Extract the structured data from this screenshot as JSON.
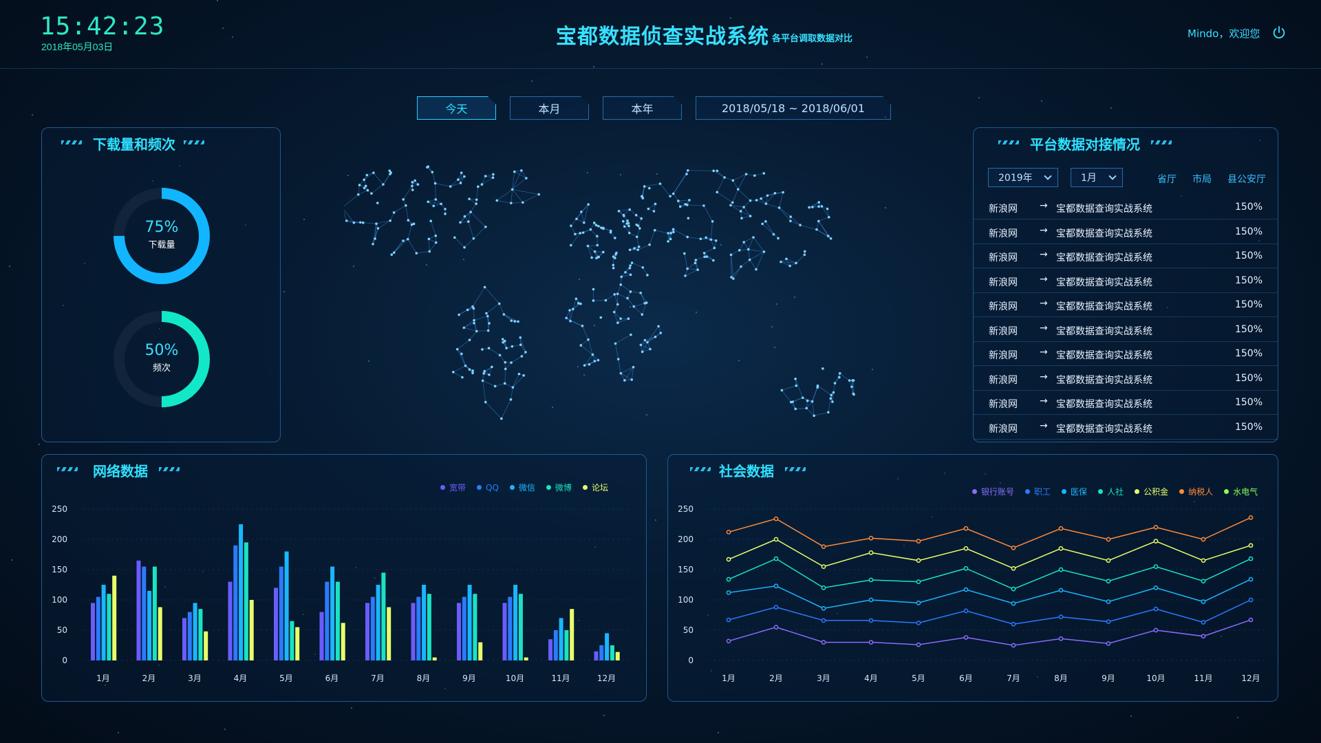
{
  "header": {
    "clock": "15:42:23",
    "date": "2018年05月03日",
    "title": "宝都数据侦查实战系统",
    "subtitle": "各平台调取数据对比",
    "welcome": "Mindo，欢迎您",
    "power_icon": "power-icon"
  },
  "tabs": {
    "today": "今天",
    "month": "本月",
    "year": "本年",
    "date_range": "2018/05/18  ~  2018/06/01"
  },
  "download_panel": {
    "title": "下载量和频次",
    "rings": [
      {
        "value": "75%",
        "label": "下载量",
        "fraction": 0.75,
        "color": "#12b5ff"
      },
      {
        "value": "50%",
        "label": "频次",
        "fraction": 0.5,
        "color": "#12e8c8"
      }
    ]
  },
  "platform_panel": {
    "title": "平台数据对接情况",
    "year_select": "2019年",
    "month_select": "1月",
    "filters": [
      "省厅",
      "市局",
      "县公安厅"
    ],
    "rows": [
      {
        "src": "新浪网",
        "dst": "宝都数据查询实战系统",
        "pct": "150%"
      },
      {
        "src": "新浪网",
        "dst": "宝都数据查询实战系统",
        "pct": "150%"
      },
      {
        "src": "新浪网",
        "dst": "宝都数据查询实战系统",
        "pct": "150%"
      },
      {
        "src": "新浪网",
        "dst": "宝都数据查询实战系统",
        "pct": "150%"
      },
      {
        "src": "新浪网",
        "dst": "宝都数据查询实战系统",
        "pct": "150%"
      },
      {
        "src": "新浪网",
        "dst": "宝都数据查询实战系统",
        "pct": "150%"
      },
      {
        "src": "新浪网",
        "dst": "宝都数据查询实战系统",
        "pct": "150%"
      },
      {
        "src": "新浪网",
        "dst": "宝都数据查询实战系统",
        "pct": "150%"
      },
      {
        "src": "新浪网",
        "dst": "宝都数据查询实战系统",
        "pct": "150%"
      },
      {
        "src": "新浪网",
        "dst": "宝都数据查询实战系统",
        "pct": "150%"
      }
    ]
  },
  "network_panel": {
    "title": "网络数据"
  },
  "social_panel": {
    "title": "社会数据"
  },
  "chart_data": [
    {
      "type": "bar",
      "categories": [
        "1月",
        "2月",
        "3月",
        "4月",
        "5月",
        "6月",
        "7月",
        "8月",
        "9月",
        "10月",
        "11月",
        "12月"
      ],
      "ylim": [
        0,
        250
      ],
      "yticks": [
        0,
        50,
        100,
        150,
        200,
        250
      ],
      "grid": true,
      "legend": "top-right",
      "series": [
        {
          "name": "宽带",
          "color": "#6a5cff",
          "values": [
            95,
            165,
            70,
            130,
            120,
            80,
            95,
            95,
            95,
            95,
            35,
            15
          ]
        },
        {
          "name": "QQ",
          "color": "#2b7bff",
          "values": [
            105,
            155,
            80,
            190,
            155,
            130,
            105,
            105,
            105,
            105,
            50,
            25
          ]
        },
        {
          "name": "微信",
          "color": "#1ab6ff",
          "values": [
            125,
            115,
            95,
            225,
            180,
            155,
            125,
            125,
            125,
            125,
            70,
            45
          ]
        },
        {
          "name": "微博",
          "color": "#19e3c3",
          "values": [
            110,
            155,
            85,
            195,
            65,
            130,
            145,
            110,
            110,
            110,
            50,
            25
          ]
        },
        {
          "name": "论坛",
          "color": "#e9ff6a",
          "values": [
            140,
            88,
            48,
            100,
            55,
            62,
            88,
            5,
            30,
            5,
            85,
            14
          ]
        }
      ]
    },
    {
      "type": "line",
      "categories": [
        "1月",
        "2月",
        "3月",
        "4月",
        "5月",
        "6月",
        "7月",
        "8月",
        "9月",
        "10月",
        "11月",
        "12月"
      ],
      "ylim": [
        0,
        250
      ],
      "yticks": [
        0,
        50,
        100,
        150,
        200,
        250
      ],
      "grid": true,
      "legend": "top-right",
      "series": [
        {
          "name": "银行账号",
          "color": "#8a6cff",
          "values": [
            32,
            55,
            30,
            30,
            26,
            38,
            25,
            36,
            28,
            50,
            40,
            67
          ]
        },
        {
          "name": "职工",
          "color": "#2b7bff",
          "values": [
            67,
            88,
            66,
            66,
            62,
            82,
            60,
            72,
            64,
            85,
            63,
            100
          ]
        },
        {
          "name": "医保",
          "color": "#1ab6ff",
          "values": [
            112,
            123,
            86,
            100,
            95,
            117,
            94,
            116,
            97,
            120,
            97,
            134
          ]
        },
        {
          "name": "人社",
          "color": "#19e3c3",
          "values": [
            134,
            168,
            120,
            133,
            130,
            152,
            118,
            150,
            131,
            155,
            131,
            168
          ]
        },
        {
          "name": "公积金",
          "color": "#e9ff6a",
          "values": [
            167,
            200,
            155,
            178,
            165,
            185,
            152,
            185,
            165,
            197,
            165,
            190
          ]
        },
        {
          "name": "纳税人",
          "color": "#ff8a3a",
          "values": [
            212,
            234,
            188,
            202,
            197,
            218,
            186,
            218,
            200,
            220,
            200,
            236
          ]
        },
        {
          "name": "水电气",
          "color": "#8cff5a",
          "values": []
        }
      ]
    }
  ]
}
